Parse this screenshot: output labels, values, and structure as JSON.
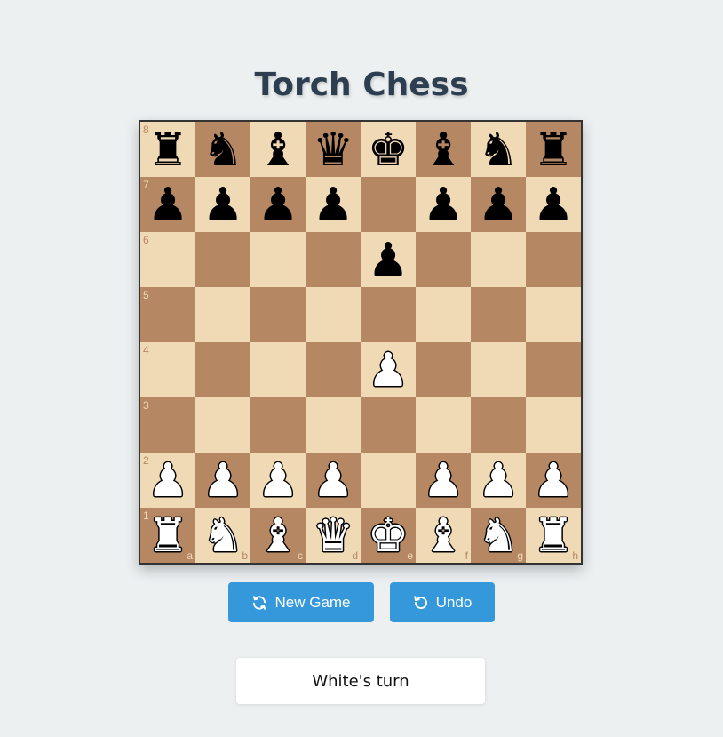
{
  "title": "Torch Chess",
  "board": {
    "ranks": [
      "8",
      "7",
      "6",
      "5",
      "4",
      "3",
      "2",
      "1"
    ],
    "files": [
      "a",
      "b",
      "c",
      "d",
      "e",
      "f",
      "g",
      "h"
    ],
    "position": [
      [
        "bR",
        "bN",
        "bB",
        "bQ",
        "bK",
        "bB",
        "bN",
        "bR"
      ],
      [
        "bP",
        "bP",
        "bP",
        "bP",
        "",
        "bP",
        "bP",
        "bP"
      ],
      [
        "",
        "",
        "",
        "",
        "bP",
        "",
        "",
        ""
      ],
      [
        "",
        "",
        "",
        "",
        "",
        "",
        "",
        ""
      ],
      [
        "",
        "",
        "",
        "",
        "wP",
        "",
        "",
        ""
      ],
      [
        "",
        "",
        "",
        "",
        "",
        "",
        "",
        ""
      ],
      [
        "wP",
        "wP",
        "wP",
        "wP",
        "",
        "wP",
        "wP",
        "wP"
      ],
      [
        "wR",
        "wN",
        "wB",
        "wQ",
        "wK",
        "wB",
        "wN",
        "wR"
      ]
    ],
    "light_color": "#f0d9b5",
    "dark_color": "#b58863"
  },
  "controls": {
    "new_game_label": "New Game",
    "new_game_icon": "refresh-icon",
    "undo_label": "Undo",
    "undo_icon": "undo-icon",
    "accent": "#3498db"
  },
  "status": {
    "text": "White's turn"
  }
}
